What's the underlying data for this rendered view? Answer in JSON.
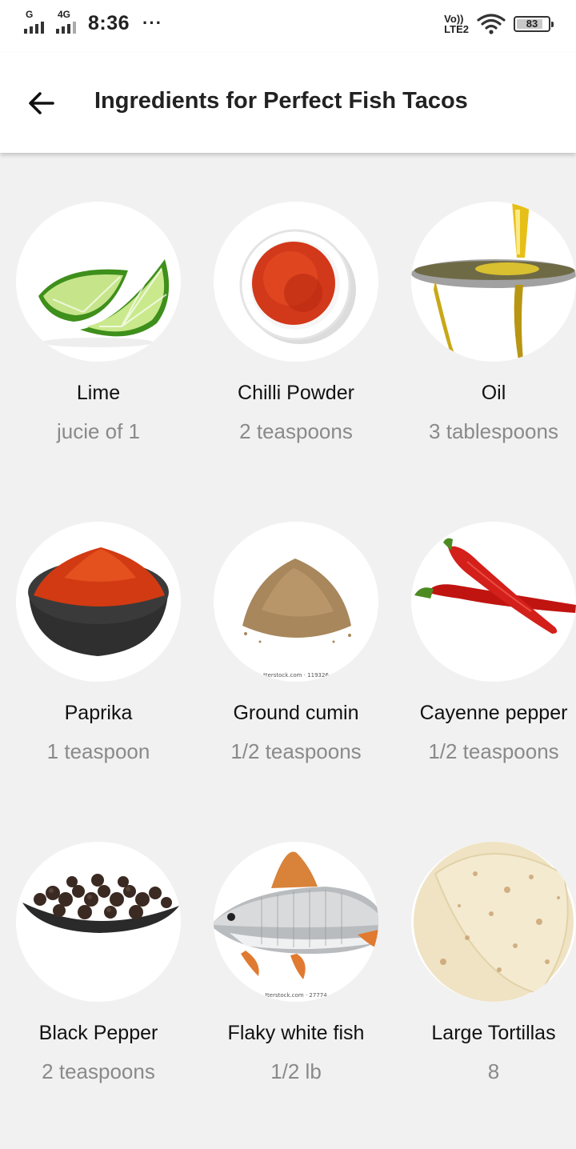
{
  "status_bar": {
    "net1": "G",
    "net2": "4G",
    "time": "8:36",
    "more": "···",
    "volte_top": "Vo))",
    "volte_bottom": "LTE2",
    "battery": "83",
    "battery_fraction": 0.83
  },
  "header": {
    "title": "Ingredients for Perfect Fish Tacos",
    "back_icon": "arrow-left-icon"
  },
  "ingredients": [
    {
      "name": "Lime",
      "qty": "jucie of 1",
      "image": "lime"
    },
    {
      "name": "Chilli Powder",
      "qty": "2 teaspoons",
      "image": "chilli-powder"
    },
    {
      "name": "Oil",
      "qty": "3 tablespoons",
      "image": "oil"
    },
    {
      "name": "Paprika",
      "qty": "1 teaspoon",
      "image": "paprika"
    },
    {
      "name": "Ground cumin",
      "qty": "1/2 teaspoons",
      "image": "cumin",
      "watermark": "tterstock.com · 119326"
    },
    {
      "name": "Cayenne pepper",
      "qty": "1/2 teaspoons",
      "image": "cayenne"
    },
    {
      "name": "Black Pepper",
      "qty": "2 teaspoons",
      "image": "black-pepper"
    },
    {
      "name": "Flaky white fish",
      "qty": "1/2 lb",
      "image": "fish",
      "watermark": "tterstock.com · 27774"
    },
    {
      "name": "Large Tortillas",
      "qty": "8",
      "image": "tortillas"
    }
  ]
}
